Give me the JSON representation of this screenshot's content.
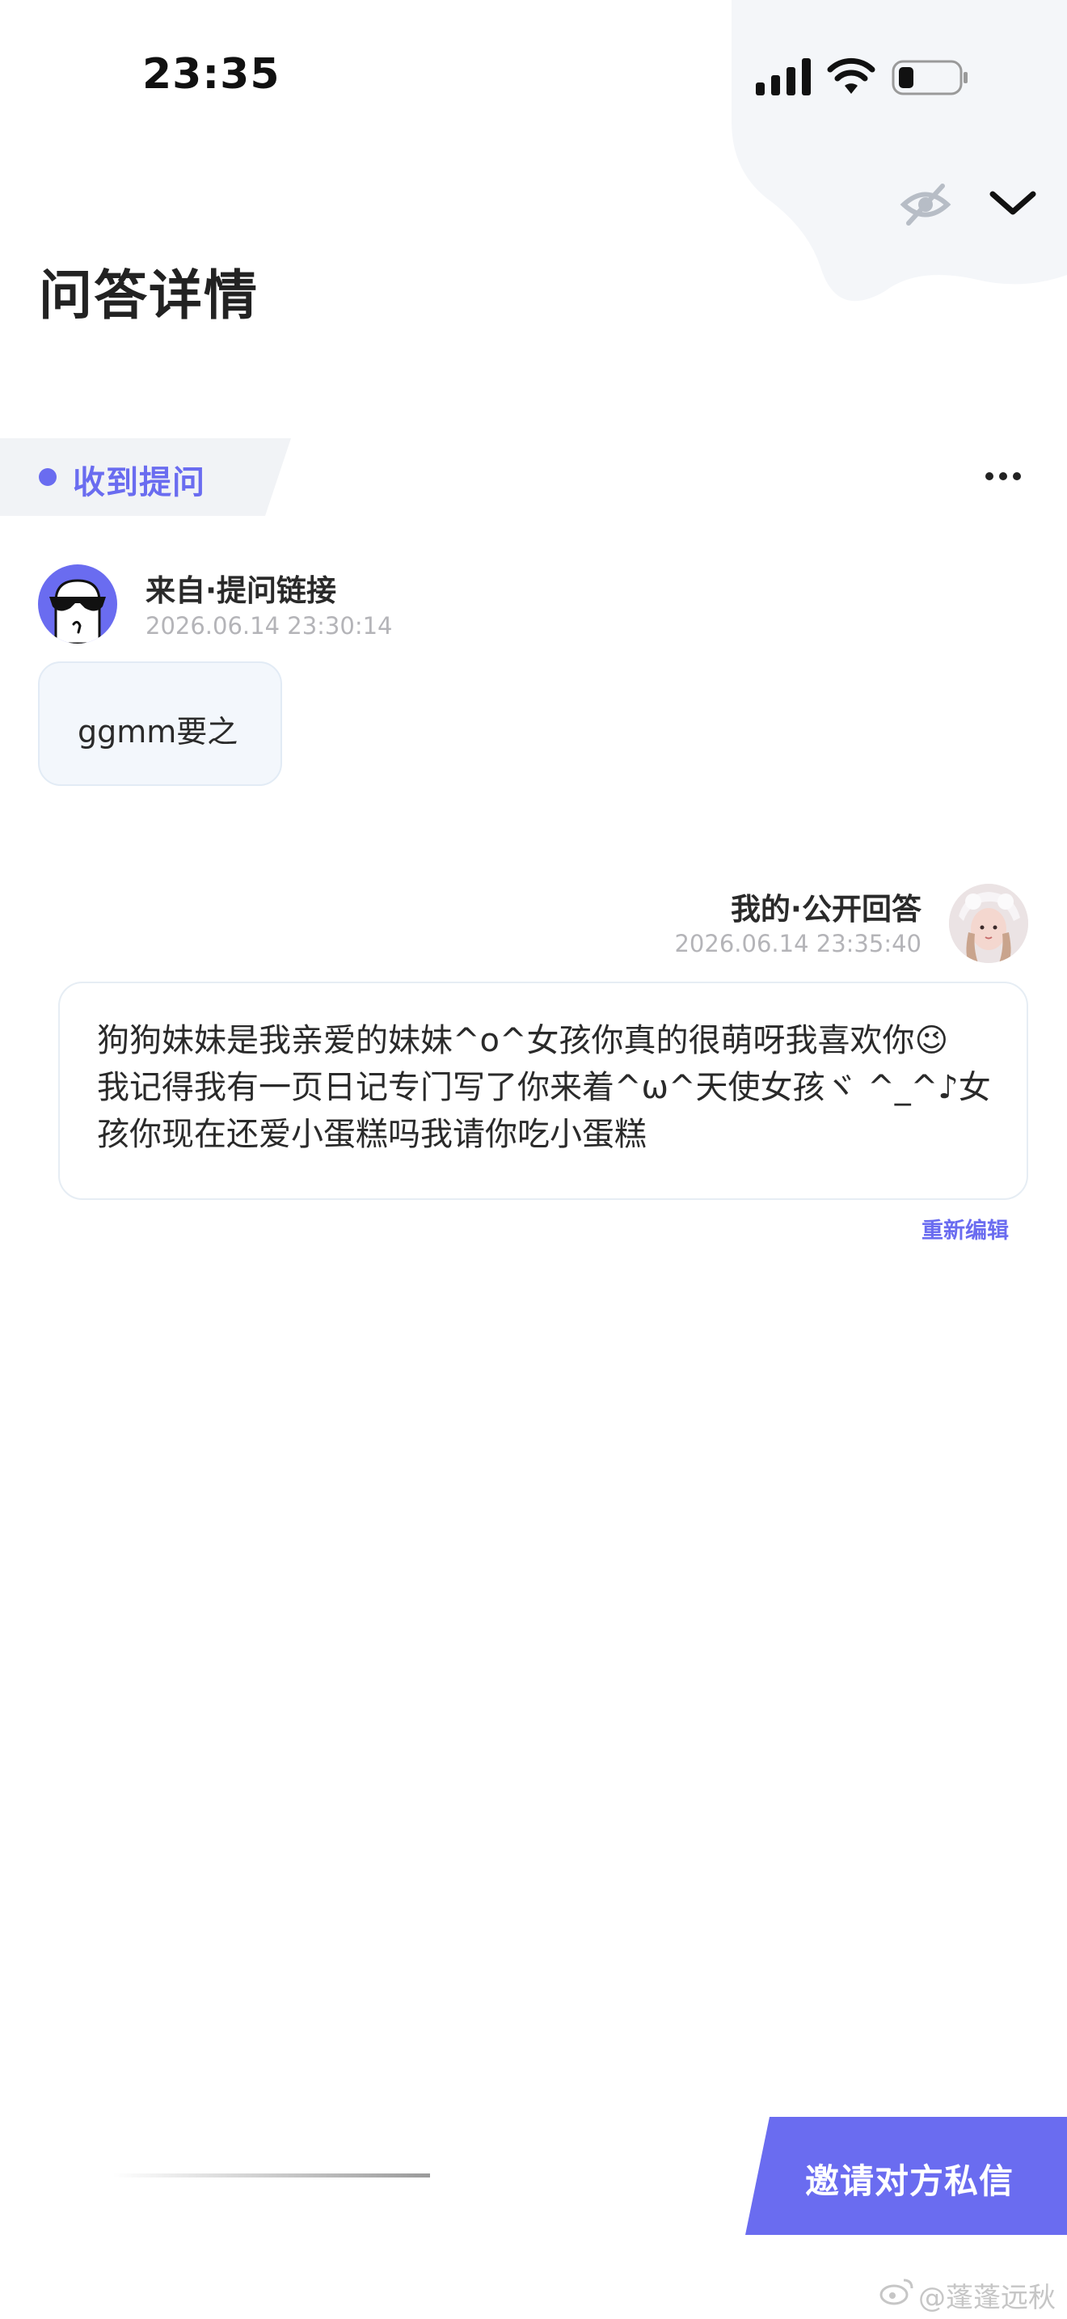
{
  "status_bar": {
    "time": "23:35"
  },
  "header": {
    "title": "问答详情"
  },
  "received": {
    "tag_label": "收到提问",
    "asker": {
      "name": "来自·提问链接",
      "time": "2026.06.14 23:30:14"
    },
    "question": "ggmm要之"
  },
  "answer": {
    "name": "我的·公开回答",
    "time": "2026.06.14 23:35:40",
    "text": "狗狗妹妹是我亲爱的妹妹^o^女孩你真的很萌呀我喜欢你😉\n我记得我有一页日记专门写了你来着^ω^天使女孩ヾ ^_^♪女\n孩你现在还爱小蛋糕吗我请你吃小蛋糕",
    "reedit_label": "重新编辑"
  },
  "bottom": {
    "invite_label": "邀请对方私信"
  },
  "watermark": "@蓬蓬远秋",
  "colors": {
    "accent": "#6a6cf0",
    "bubble_bg": "#f3f7fc"
  },
  "icons": [
    "signal-icon",
    "wifi-icon",
    "battery-icon",
    "eye-off-icon",
    "chevron-down-icon",
    "more-icon",
    "weibo-icon"
  ]
}
